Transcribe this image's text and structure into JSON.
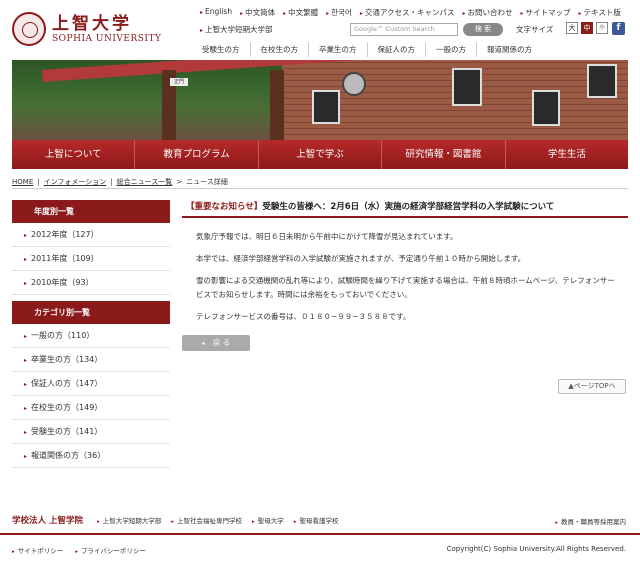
{
  "header": {
    "logo_jp": "上智大学",
    "logo_en": "SOPHIA UNIVERSITY",
    "utility": [
      "English",
      "中文简体",
      "中文繁體",
      "한국어",
      "交通アクセス・キャンパス",
      "お問い合わせ",
      "サイトマップ",
      "テキスト版"
    ],
    "junior_college": "上智大学短期大学部",
    "search_placeholder": "Google™ Custom Search",
    "search_label": "検 索",
    "text_size_label": "文字サイズ",
    "size_large": "大",
    "size_mid": "中",
    "size_small": "小",
    "facebook": "f",
    "audience": [
      "受験生の方",
      "在校生の方",
      "卒業生の方",
      "保証人の方",
      "一般の方",
      "報道関係の方"
    ]
  },
  "hero": {
    "sign": "正門"
  },
  "nav": [
    "上智について",
    "教育プログラム",
    "上智で学ぶ",
    "研究情報・図書館",
    "学生生活"
  ],
  "breadcrumb": [
    "HOME",
    "インフォメーション",
    "総合ニュース一覧",
    "ニュース詳細"
  ],
  "sidebar": {
    "year_heading": "年度別一覧",
    "years": [
      "2012年度（127）",
      "2011年度（109）",
      "2010年度（93）"
    ],
    "category_heading": "カテゴリ別一覧",
    "categories": [
      "一般の方（110）",
      "卒業生の方（134）",
      "保証人の方（147）",
      "在校生の方（149）",
      "受験生の方（141）",
      "報道関係の方（36）"
    ]
  },
  "article": {
    "title_tag": "【重要なお知らせ】",
    "title": "受験生の皆様へ：2月6日（水）実施の経済学部経営学科の入学試験について",
    "paragraphs": [
      "気象庁予報では、明日６日未明から午前中にかけて降雪が見込まれています。",
      "本学では、経済学部経営学科の入学試験が実施されますが、予定通り午前１０時から開始します。",
      "雪の影響による交通機関の乱れ等により、試験時間を繰り下げて実施する場合は、午前８時頃ホームページ、テレフォンサービスでお知らせします。時間には余裕をもっておいでください。",
      "テレフォンサービスの番号は、０１８０−９９−３５８８です。"
    ],
    "back_label": "戻 る",
    "pagetop_label": "▲ページTOPへ"
  },
  "footer": {
    "org": "学校法人 上智学院",
    "links": [
      "上智大学短期大学部",
      "上智社会福祉専門学校",
      "聖母大学",
      "聖母看護学校"
    ],
    "staff_link": "教員・職員等採用案内",
    "policies": [
      "サイトポリシー",
      "プライバシーポリシー"
    ],
    "copyright": "Copyright(C) Sophia University.All Rights Reserved."
  }
}
